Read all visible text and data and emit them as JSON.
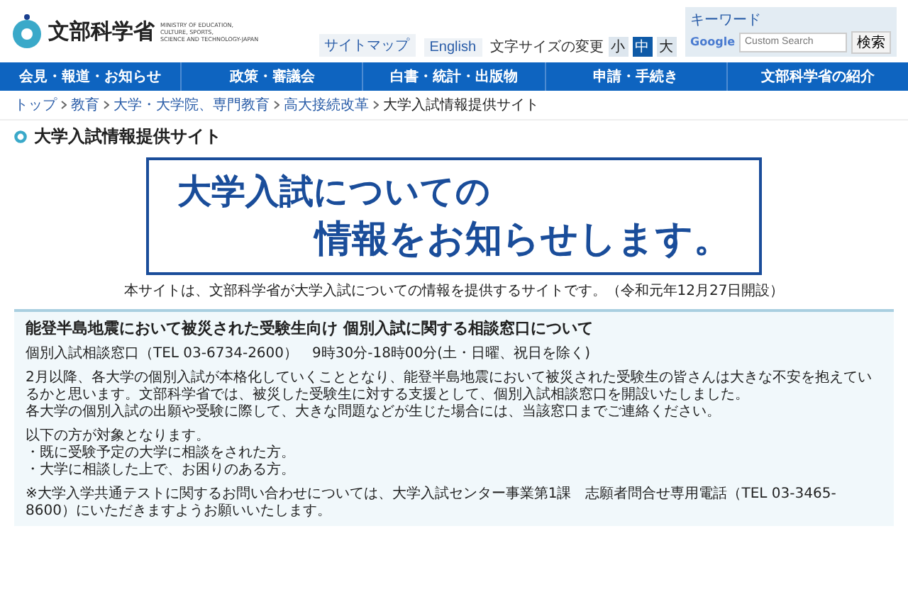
{
  "header": {
    "logo_text": "文部科学省",
    "logo_english": [
      "MINISTRY OF EDUCATION,",
      "CULTURE, SPORTS,",
      "SCIENCE AND TECHNOLOGY-JAPAN"
    ],
    "links": [
      {
        "label": "サイトマップ"
      },
      {
        "label": "English"
      }
    ],
    "font_size": {
      "label": "文字サイズの変更",
      "options": [
        {
          "label": "小",
          "selected": false
        },
        {
          "label": "中",
          "selected": true
        },
        {
          "label": "大",
          "selected": false
        }
      ]
    },
    "search": {
      "label": "キーワード",
      "logo": "Google",
      "placeholder": "Custom Search",
      "button": "検索"
    }
  },
  "nav": [
    {
      "label": "会見・報道・お知らせ"
    },
    {
      "label": "政策・審議会"
    },
    {
      "label": "白書・統計・出版物"
    },
    {
      "label": "申請・手続き"
    },
    {
      "label": "文部科学省の紹介"
    }
  ],
  "breadcrumb": [
    {
      "label": "トップ",
      "link": true
    },
    {
      "label": "教育",
      "link": true
    },
    {
      "label": "大学・大学院、専門教育",
      "link": true
    },
    {
      "label": "高大接続改革",
      "link": true
    },
    {
      "label": "大学入試情報提供サイト",
      "link": false
    }
  ],
  "page_title": "大学入試情報提供サイト",
  "hero": {
    "lines": [
      "大学入試についての",
      "情報をお知らせします。"
    ]
  },
  "caption": "本サイトは、文部科学省が大学入試についての情報を提供するサイトです。（令和元年12月27日開設）",
  "notice": {
    "title": "能登半島地震において被災された受験生向け 個別入試に関する相談窓口について",
    "blocks": [
      {
        "kind": "para",
        "lines": [
          "個別入試相談窓口（TEL 03-6734-2600）　9時30分-18時00分(土・日曜、祝日を除く)"
        ]
      },
      {
        "kind": "para",
        "lines": [
          "2月以降、各大学の個別入試が本格化していくこととなり、能登半島地震において被災された受験生の皆さんは大きな不安を抱えているかと思います。文部科学省では、被災した受験生に対する支援として、個別入試相談窓口を開設いたしました。",
          "各大学の個別入試の出願や受験に際して、大きな問題などが生じた場合には、当該窓口までご連絡ください。"
        ]
      },
      {
        "kind": "para",
        "lines": [
          "以下の方が対象となります。",
          "・既に受験予定の大学に相談をされた方。",
          "・大学に相談した上で、お困りのある方。"
        ]
      },
      {
        "kind": "para",
        "lines": [
          "※大学入学共通テストに関するお問い合わせについては、大学入試センター事業第1課　志願者問合せ専用電話（TEL 03-3465-8600）にいただきますようお願いいたします。"
        ]
      }
    ]
  }
}
